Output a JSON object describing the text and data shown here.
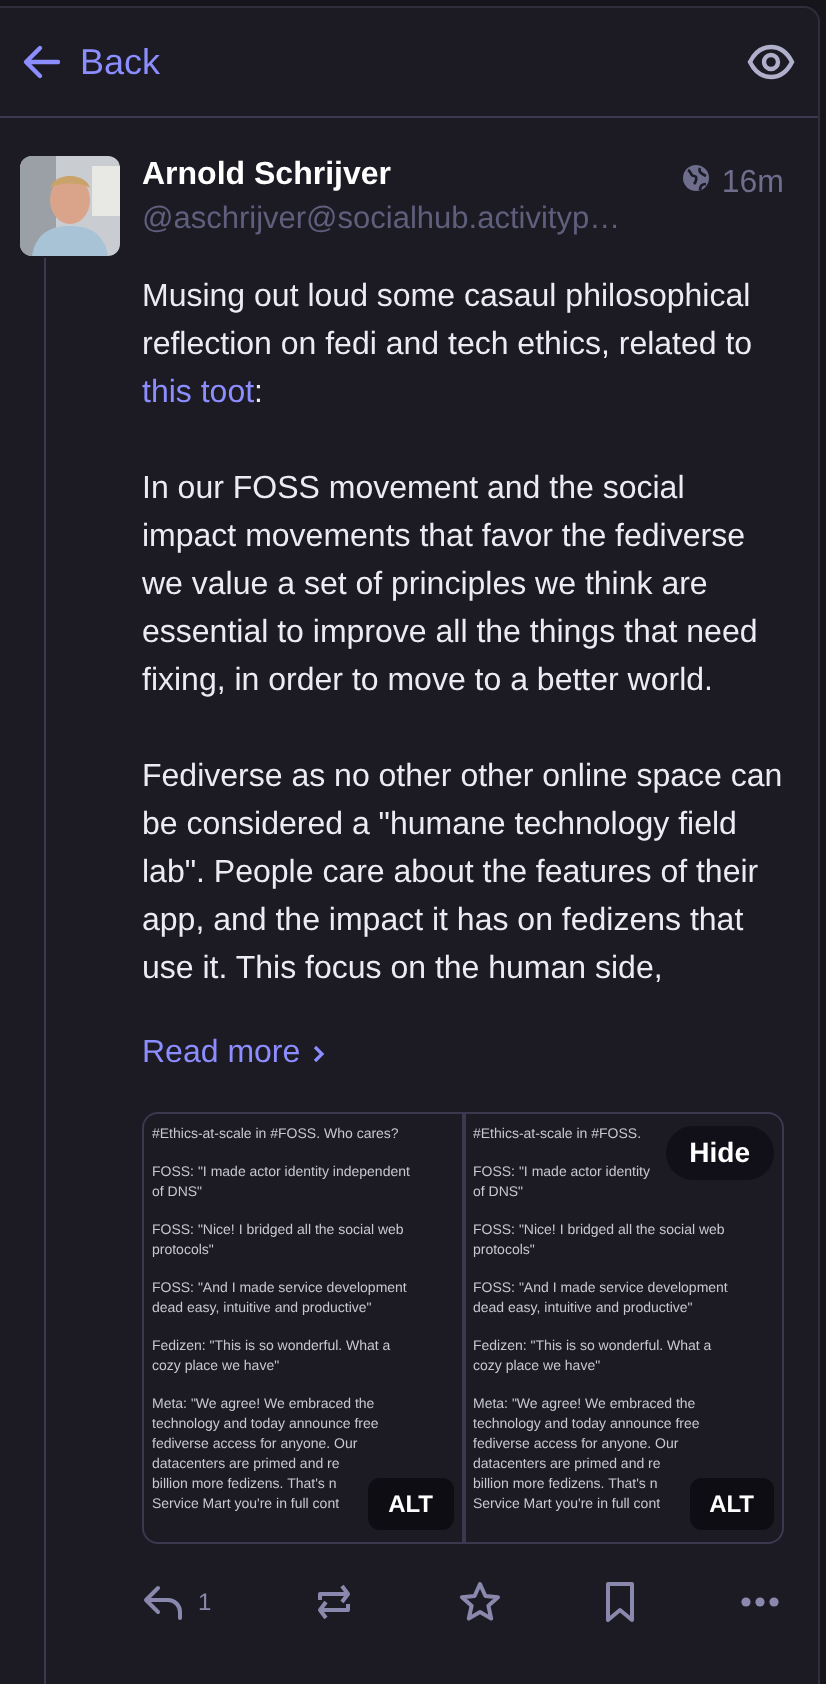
{
  "header": {
    "back_label": "Back"
  },
  "post": {
    "author": "Arnold Schrijver",
    "handle": "@aschrijver@socialhub.activityp…",
    "time": "16m",
    "paragraphs": [
      {
        "parts": [
          {
            "text": "Musing out loud some casaul philosophical reflection on fedi and tech ethics, related to "
          },
          {
            "text": "this toot",
            "kind": "link"
          },
          {
            "text": ":"
          }
        ]
      },
      {
        "parts": [
          {
            "text": "In our FOSS movement and the social impact movements that favor the fediverse we value a set of principles we think are essential to improve all the things that need fixing, in order to move to a better world."
          }
        ]
      },
      {
        "parts": [
          {
            "text": "Fediverse as no other other online space can be considered a \"humane technology field lab\". People care about the features of their app, and the impact it has on fedizens that use it. This focus on the human side,"
          }
        ]
      }
    ],
    "read_more": "Read more",
    "hide_label": "Hide",
    "attachments": [
      {
        "alt_label": "ALT",
        "paragraphs": [
          [
            "#Ethics-at-scale in #FOSS. Who cares?"
          ],
          [
            "FOSS: \"I made actor identity independent",
            "of DNS\""
          ],
          [
            "FOSS: \"Nice! I bridged all the social web",
            "protocols\""
          ],
          [
            "FOSS: \"And I made service development",
            "dead easy, intuitive and productive\""
          ],
          [
            "Fedizen: \"This is so wonderful. What a",
            "cozy place we have\""
          ],
          [
            "Meta: \"We agree! We embraced the",
            "technology and today announce free",
            "fediverse access for anyone. Our",
            "datacenters are primed and re",
            "billion more fedizens. That's n",
            "Service Mart you're in full cont"
          ]
        ]
      },
      {
        "alt_label": "ALT",
        "paragraphs": [
          [
            "#Ethics-at-scale in #FOSS."
          ],
          [
            "FOSS: \"I made actor identity",
            "of DNS\""
          ],
          [
            "FOSS: \"Nice! I bridged all the social web",
            "protocols\""
          ],
          [
            "FOSS: \"And I made service development",
            "dead easy, intuitive and productive\""
          ],
          [
            "Fedizen: \"This is so wonderful. What a",
            "cozy place we have\""
          ],
          [
            "Meta: \"We agree! We embraced the",
            "technology and today announce free",
            "fediverse access for anyone. Our",
            "datacenters are primed and re",
            "billion more fedizens. That's n",
            "Service Mart you're in full cont"
          ]
        ]
      }
    ],
    "reply_count": "1"
  }
}
